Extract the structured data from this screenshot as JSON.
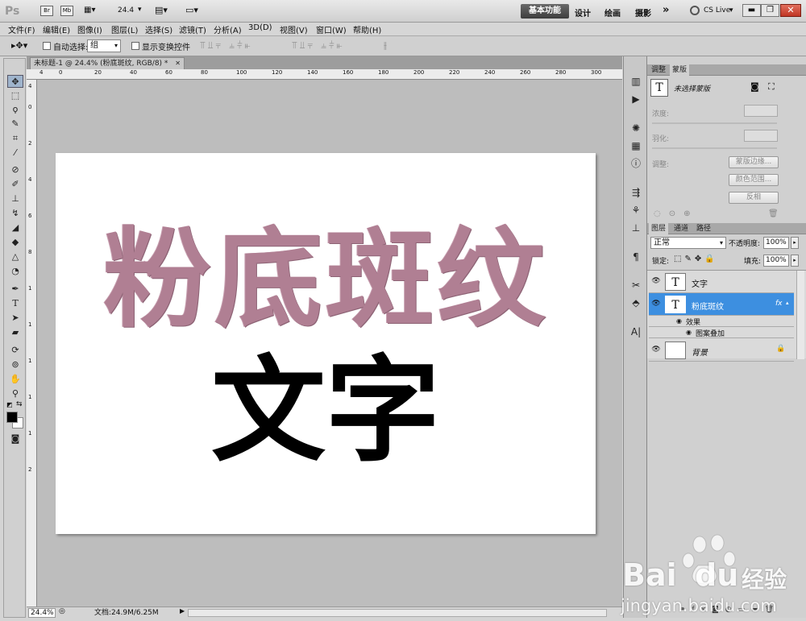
{
  "appbar": {
    "logo": "Ps",
    "br": "Br",
    "mb": "Mb",
    "zoom": "24.4",
    "workspaces": [
      "基本功能",
      "设计",
      "绘画",
      "摄影"
    ],
    "more": "»",
    "cs_live": "CS Live"
  },
  "menu": [
    "文件(F)",
    "编辑(E)",
    "图像(I)",
    "图层(L)",
    "选择(S)",
    "滤镜(T)",
    "分析(A)",
    "3D(D)",
    "视图(V)",
    "窗口(W)",
    "帮助(H)"
  ],
  "options": {
    "auto_select_label": "自动选择:",
    "auto_select_value": "组",
    "show_transform_label": "显示变换控件"
  },
  "document": {
    "tab_title": "未标题-1 @ 24.4% (粉底斑纹, RGB/8) *",
    "ruler_h": [
      "4",
      "0",
      "20",
      "40",
      "60",
      "80",
      "100",
      "120",
      "140",
      "160",
      "180",
      "200",
      "220",
      "240",
      "260",
      "280",
      "300"
    ],
    "ruler_v": [
      "4",
      "0",
      "2",
      "4",
      "6",
      "8",
      "1",
      "1",
      "1",
      "1",
      "1",
      "2"
    ],
    "canvas_text_pink": "粉底斑纹",
    "canvas_text_black": "文字"
  },
  "status": {
    "zoom": "24.4%",
    "doc_info": "文档:24.9M/6.25M"
  },
  "masks_panel": {
    "tabs": [
      "调整",
      "蒙版"
    ],
    "title": "未选择蒙版",
    "density_label": "浓度:",
    "feather_label": "羽化:",
    "refine_label": "调整:",
    "btn_mask_edge": "蒙版边缘...",
    "btn_color_range": "颜色范围...",
    "btn_invert": "反相"
  },
  "layers_panel": {
    "tabs": [
      "图层",
      "通道",
      "路径"
    ],
    "blend_mode": "正常",
    "opacity_label": "不透明度:",
    "opacity_value": "100%",
    "lock_label": "锁定:",
    "fill_label": "填充:",
    "fill_value": "100%",
    "layers": [
      {
        "name": "文字",
        "thumb": "T"
      },
      {
        "name": "粉底斑纹",
        "thumb": "T",
        "selected": true
      },
      {
        "name": "背景",
        "thumb": ""
      }
    ],
    "effects_label": "效果",
    "effect_item": "图案叠加"
  },
  "watermark": {
    "brand": "Bai",
    "brand2": "du",
    "jingyan_cn": "经验",
    "url": "jingyan.baidu.com"
  },
  "colors": {
    "accent": "#3d8fe0",
    "pink": "#b07f93"
  }
}
